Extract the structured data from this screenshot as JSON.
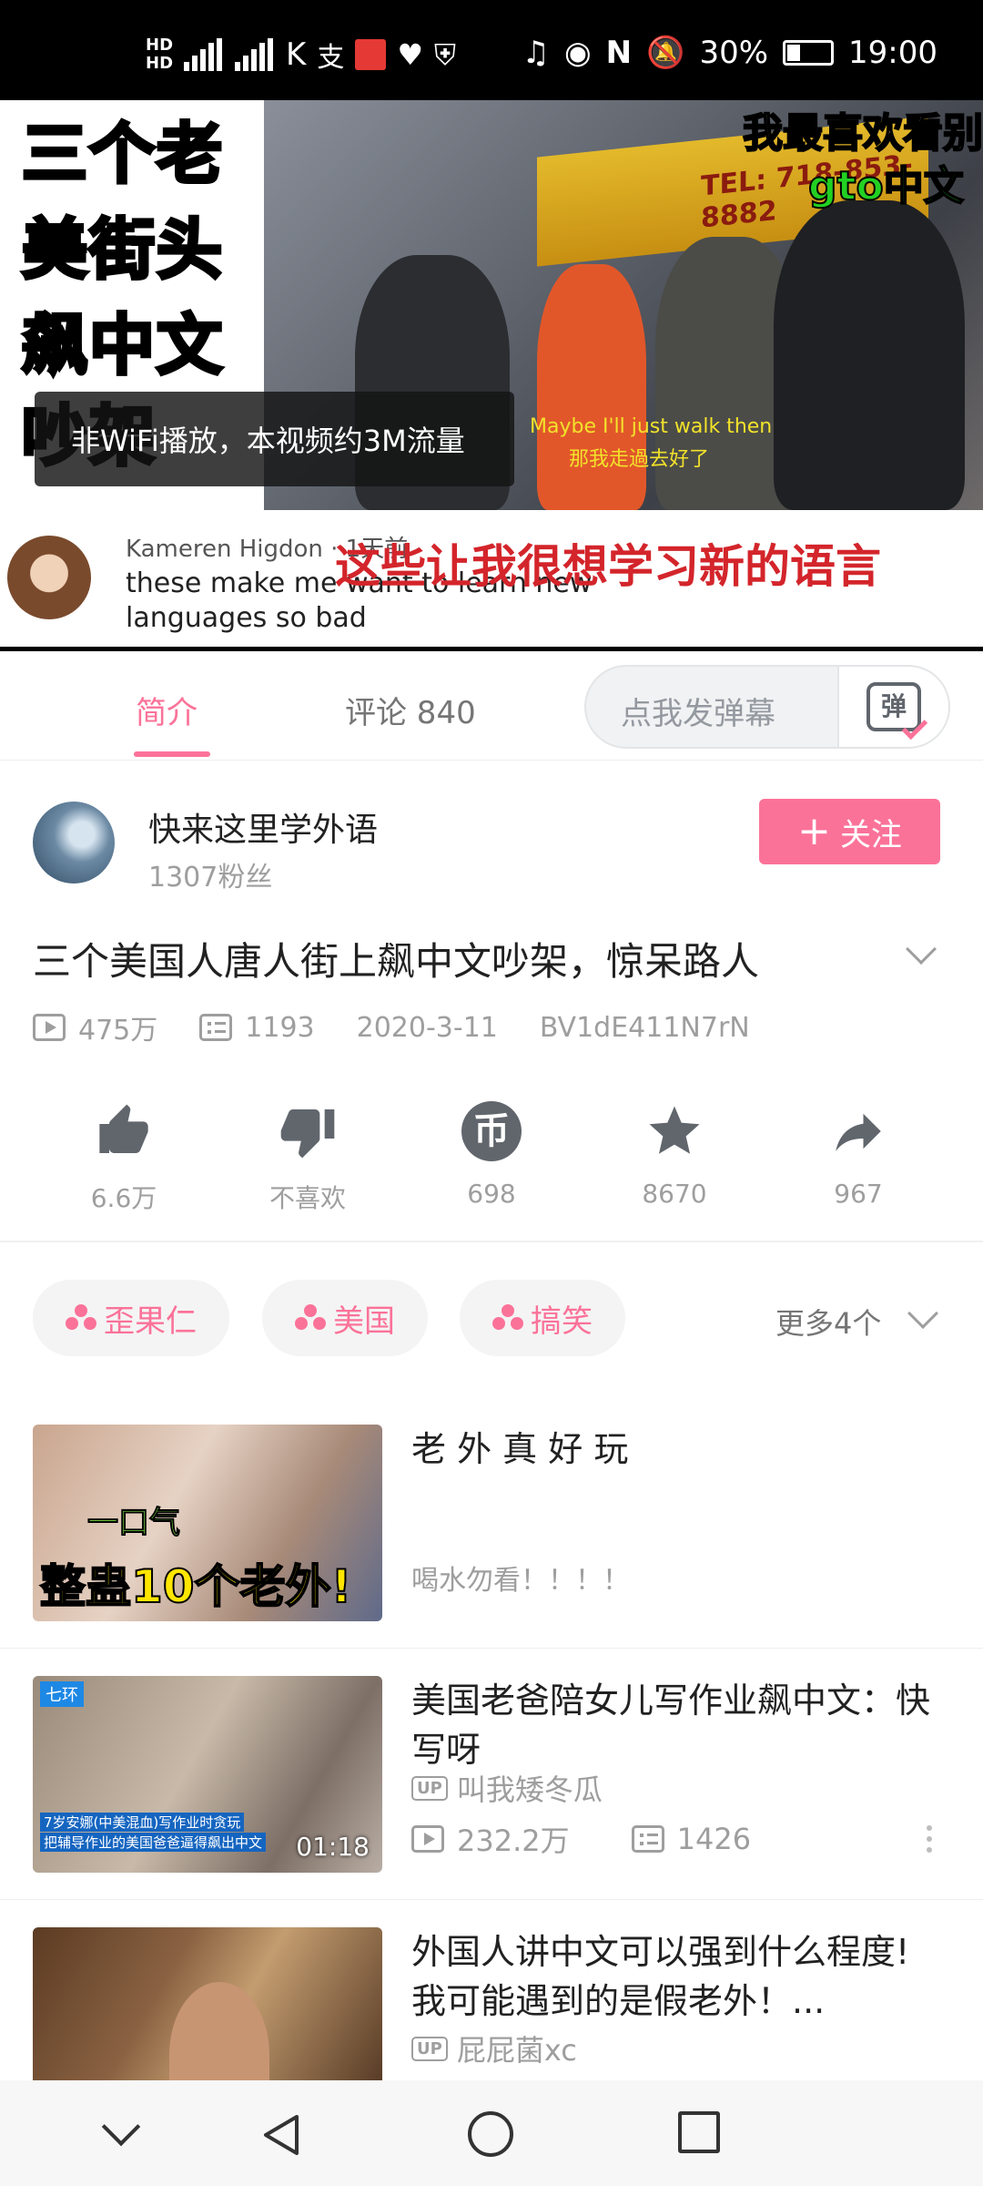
{
  "status_bar": {
    "hd1": "HD",
    "hd2": "HD",
    "net": "4G",
    "battery_pct": "30%",
    "battery_level": 0.3,
    "time": "19:00"
  },
  "video": {
    "overlay_title_lines": [
      "三个老",
      "美街头",
      "飙中文",
      "吵架"
    ],
    "top_right_caption": "我最喜欢看别",
    "green_caption": "gto中文",
    "storefront_text": "TEL: 718-853-8882",
    "subtitle_en": "Maybe I'll just walk then",
    "subtitle_zh": "那我走過去好了",
    "toast": "非WiFi播放，本视频约3M流量",
    "comment_name": "Kameren Higdon · 1天前",
    "comment_text": "these make me want to learn new languages so bad",
    "comment_red": "这些让我很想学习新的语言"
  },
  "tabs": {
    "intro": "简介",
    "comments": "评论 840",
    "danmaku_placeholder": "点我发弹幕",
    "danmaku_icon_char": "弹"
  },
  "uploader": {
    "name": "快来这里学外语",
    "fans": "1307粉丝",
    "follow": "关注",
    "follow_plus": "+"
  },
  "video_info": {
    "title": "三个美国人唐人街上飙中文吵架，惊呆路人",
    "views": "475万",
    "danmaku": "1193",
    "date": "2020-3-11",
    "bvid": "BV1dE411N7rN"
  },
  "actions": {
    "like": "6.6万",
    "dislike": "不喜欢",
    "coin": "698",
    "coin_glyph": "币",
    "favorite": "8670",
    "share": "967"
  },
  "tags": {
    "items": [
      "歪果仁",
      "美国",
      "搞笑"
    ],
    "more": "更多4个"
  },
  "recommendations": [
    {
      "title": "老 外 真 好 玩",
      "desc": "喝水勿看！！！！",
      "thumb_text_top": "一口气",
      "thumb_text": "整蛊10个老外!"
    },
    {
      "title": "美国老爸陪女儿写作业飙中文：快写呀",
      "uploader": "叫我矮冬瓜",
      "views": "232.2万",
      "danmaku": "1426",
      "duration": "01:18",
      "thumb_badge": "七环",
      "thumb_line1": "7岁安娜(中美混血)写作业时贪玩",
      "thumb_line2": "把辅导作业的美国爸爸逼得飙出中文"
    },
    {
      "title": "外国人讲中文可以强到什么程度! 我可能遇到的是假老外！...",
      "uploader": "屁屁菌xc"
    }
  ],
  "up_badge": "UP"
}
